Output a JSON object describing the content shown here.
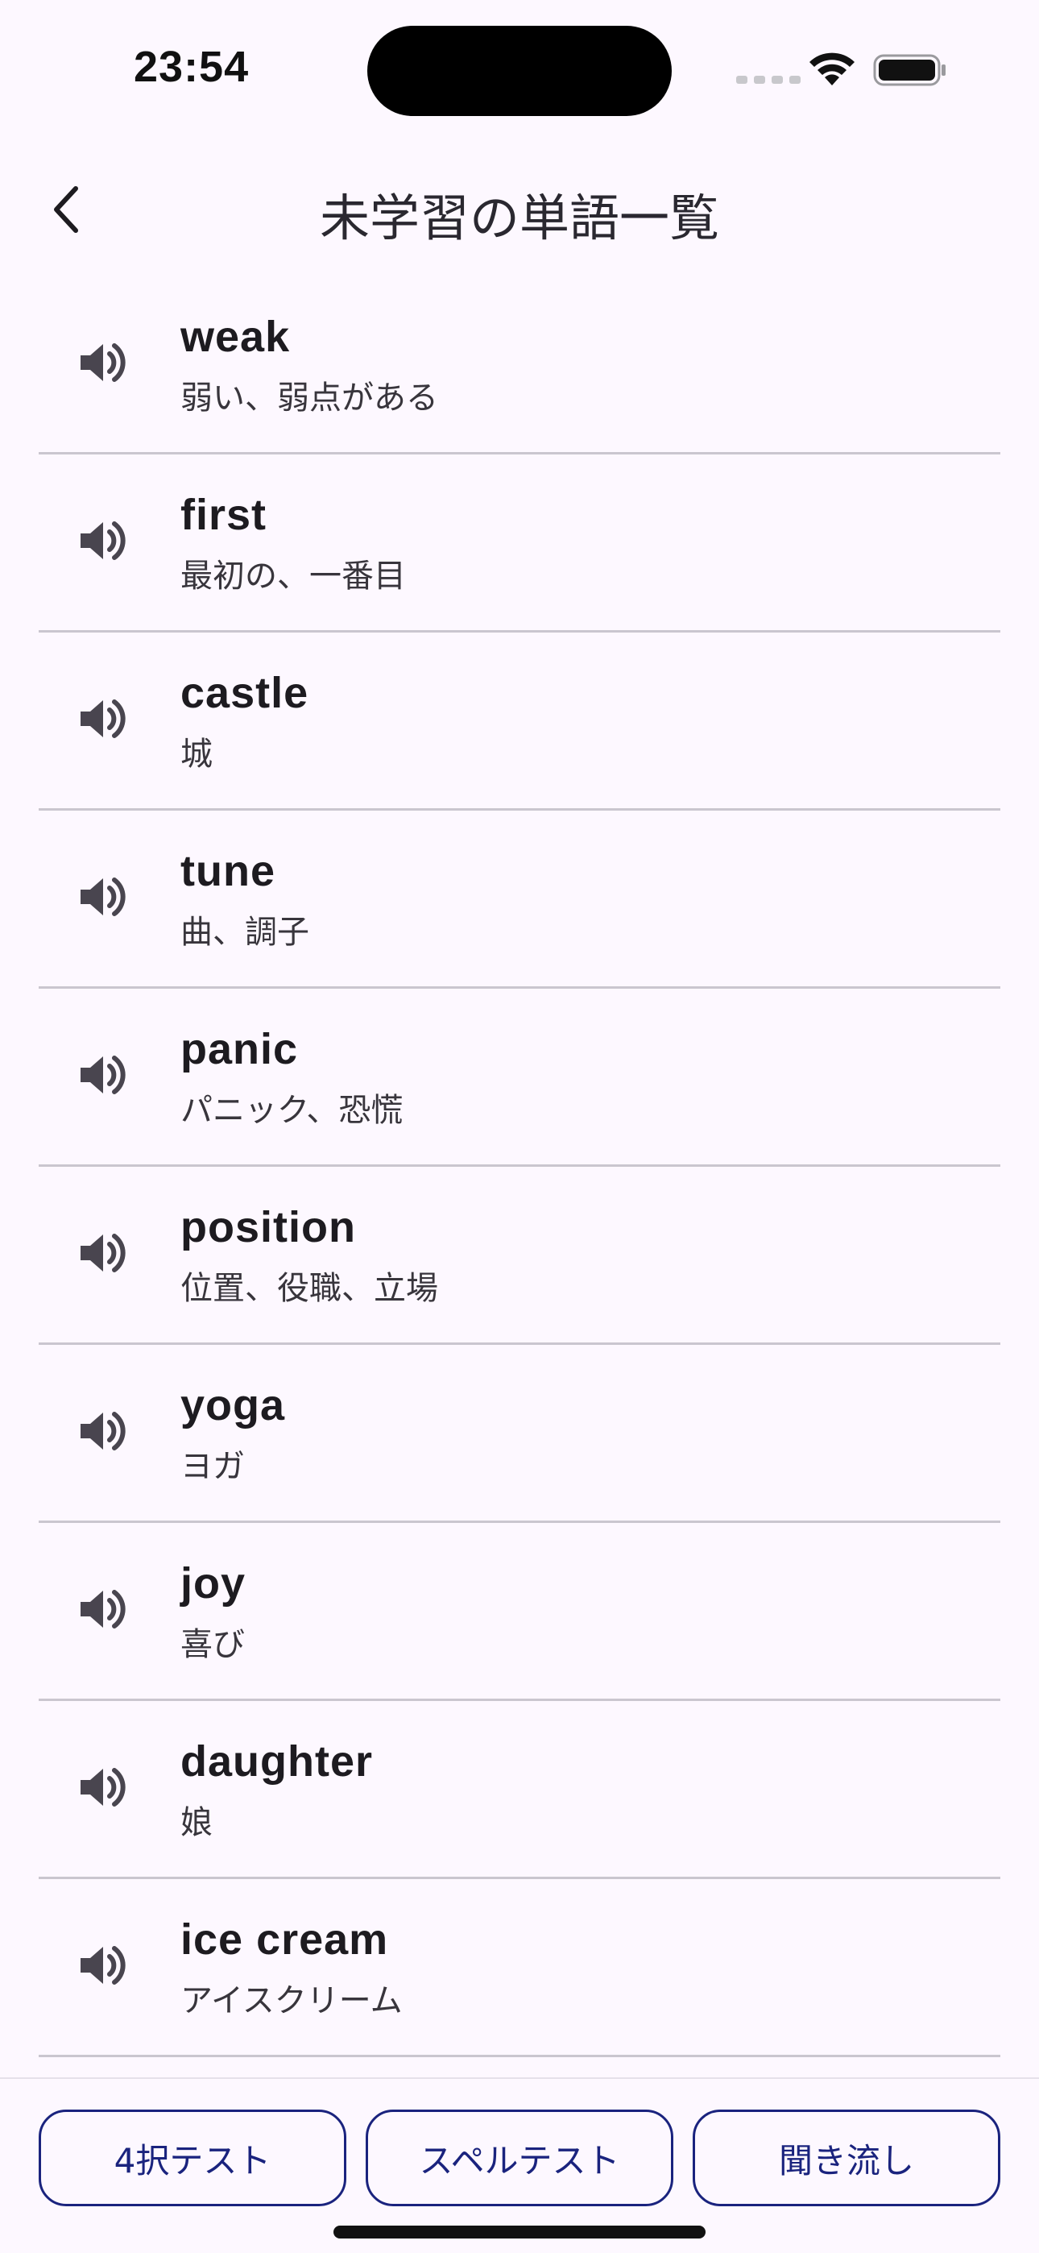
{
  "status_bar": {
    "time": "23:54",
    "wifi_icon": "wifi-icon",
    "battery_icon": "battery-icon"
  },
  "header": {
    "back_icon": "chevron-left-icon",
    "title": "未学習の単語一覧"
  },
  "words": [
    {
      "word": "weak",
      "meaning": "弱い、弱点がある"
    },
    {
      "word": "first",
      "meaning": "最初の、一番目"
    },
    {
      "word": "castle",
      "meaning": "城"
    },
    {
      "word": "tune",
      "meaning": "曲、調子"
    },
    {
      "word": "panic",
      "meaning": "パニック、恐慌"
    },
    {
      "word": "position",
      "meaning": "位置、役職、立場"
    },
    {
      "word": "yoga",
      "meaning": "ヨガ"
    },
    {
      "word": "joy",
      "meaning": "喜び"
    },
    {
      "word": "daughter",
      "meaning": "娘"
    },
    {
      "word": "ice cream",
      "meaning": "アイスクリーム"
    }
  ],
  "speaker_icon": "speaker-icon",
  "bottom_bar": {
    "buttons": [
      {
        "label": "4択テスト"
      },
      {
        "label": "スペルテスト"
      },
      {
        "label": "聞き流し"
      }
    ]
  },
  "colors": {
    "background": "#fdf8ff",
    "button_border": "#1a237e",
    "divider": "#cac6cf"
  }
}
